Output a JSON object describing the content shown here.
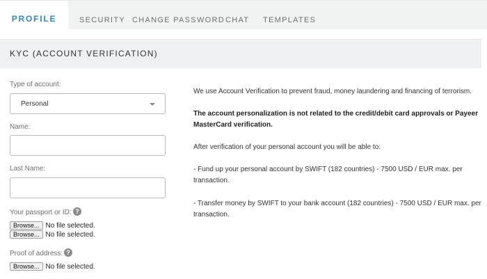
{
  "tabs": [
    {
      "label": "PROFILE",
      "active": true
    },
    {
      "label": "SECURITY",
      "active": false
    },
    {
      "label": "CHANGE PASSWORD",
      "active": false
    },
    {
      "label": "CHAT",
      "active": false
    },
    {
      "label": "TEMPLATES",
      "active": false
    }
  ],
  "section": {
    "title": "KYC (ACCOUNT VERIFICATION)"
  },
  "form": {
    "account_type_label": "Type of account:",
    "account_type_value": "Personal",
    "name_label": "Name:",
    "name_value": "",
    "last_name_label": "Last Name:",
    "last_name_value": "",
    "passport_label": "Your passport or ID:",
    "address_label": "Proof of address:",
    "help_glyph": "?",
    "browse_label": "Browse...",
    "no_file": "No file selected."
  },
  "info": {
    "p1": "We use Account Verification to prevent fraud, money laundering and financing of terrorism.",
    "p2": "The account personalization is not related to the credit/debit card approvals or Payeer MasterCard verification.",
    "p3": "After verification of your personal account you will be able to:",
    "p4": "- Fund up your personal account by SWIFT (182 countries) - 7500 USD / EUR max. per transaction.",
    "p5": "- Transfer money by SWIFT to your bank account (182 countries) - 7500 USD / EUR max. per transaction."
  },
  "colors": {
    "accent": "#2b8bc3",
    "tab_bar": "#f1f2f2",
    "section_header": "#eef0f1"
  }
}
